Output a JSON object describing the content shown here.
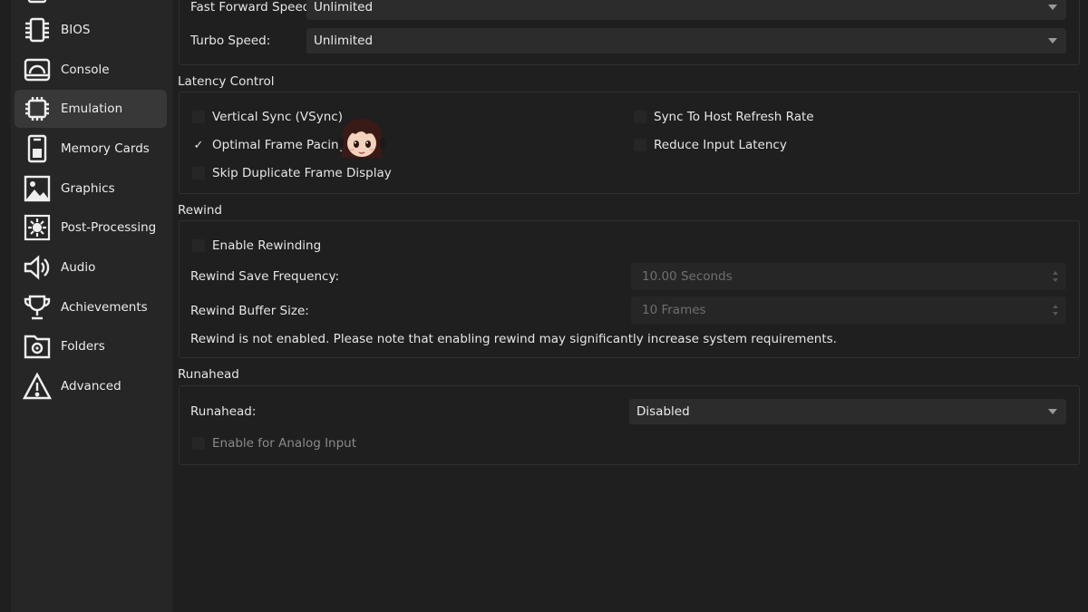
{
  "sidebar": {
    "items": [
      {
        "label": "BIOS",
        "icon": "chip-icon"
      },
      {
        "label": "Console",
        "icon": "console-icon"
      },
      {
        "label": "Emulation",
        "icon": "cpu-icon",
        "active": true
      },
      {
        "label": "Memory Cards",
        "icon": "memory-card-icon"
      },
      {
        "label": "Graphics",
        "icon": "image-icon"
      },
      {
        "label": "Post-Processing",
        "icon": "brightness-icon"
      },
      {
        "label": "Audio",
        "icon": "speaker-icon"
      },
      {
        "label": "Achievements",
        "icon": "trophy-icon"
      },
      {
        "label": "Folders",
        "icon": "folder-gear-icon"
      },
      {
        "label": "Advanced",
        "icon": "warning-icon"
      }
    ]
  },
  "speed": {
    "fast_forward_label": "Fast Forward Speed:",
    "fast_forward_value": "Unlimited",
    "turbo_label": "Turbo Speed:",
    "turbo_value": "Unlimited"
  },
  "latency": {
    "title": "Latency Control",
    "vsync": {
      "label": "Vertical Sync (VSync)",
      "checked": false
    },
    "optimal_pacing": {
      "label": "Optimal Frame Pacing",
      "checked": true,
      "mark": "✓"
    },
    "skip_duplicate": {
      "label": "Skip Duplicate Frame Display",
      "checked": false
    },
    "sync_host": {
      "label": "Sync To Host Refresh Rate",
      "checked": false
    },
    "reduce_latency": {
      "label": "Reduce Input Latency",
      "checked": false
    }
  },
  "rewind": {
    "title": "Rewind",
    "enable": {
      "label": "Enable Rewinding",
      "checked": false
    },
    "save_freq_label": "Rewind Save Frequency:",
    "save_freq_value": "10.00 Seconds",
    "buffer_label": "Rewind Buffer Size:",
    "buffer_value": "10 Frames",
    "note": "Rewind is not enabled. Please note that enabling rewind may significantly increase system requirements."
  },
  "runahead": {
    "title": "Runahead",
    "label": "Runahead:",
    "value": "Disabled",
    "analog": {
      "label": "Enable for Analog Input",
      "checked": false
    }
  },
  "colors": {
    "background": "#1f1f1f",
    "sidebar": "#262626",
    "active_item": "#383838",
    "input": "#2c2c2c",
    "text": "#e6e6e6",
    "disabled_text": "#8a8a8a"
  }
}
